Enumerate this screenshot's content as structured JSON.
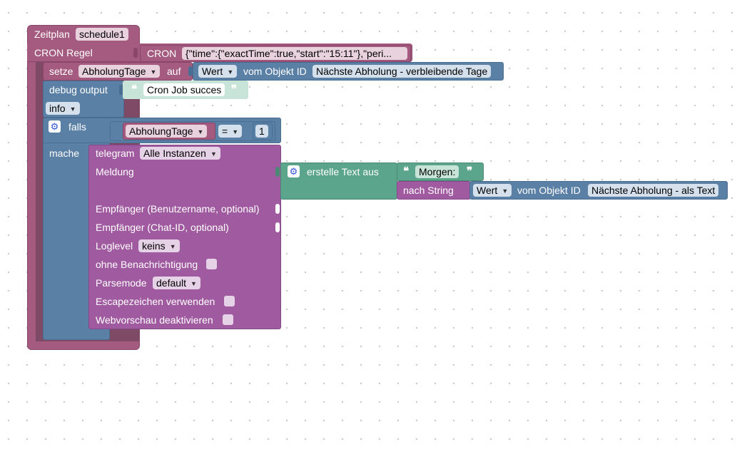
{
  "schedule": {
    "label": "Zeitplan",
    "name": "schedule1",
    "cron_label": "CRON Regel",
    "cron_block_label": "CRON",
    "cron_value": "{\"time\":{\"exactTime\":true,\"start\":\"15:11\"},\"peri..."
  },
  "set_block": {
    "label": "setze",
    "variable": "AbholungTage",
    "to_label": "auf",
    "value_attr": "Wert",
    "from_label": "vom Objekt ID",
    "object_id": "Nächste Abholung - verbleibende Tage"
  },
  "debug_block": {
    "label": "debug output",
    "text": "Cron Job succes",
    "level": "info"
  },
  "if_block": {
    "label": "falls",
    "do_label": "mache",
    "variable": "AbholungTage",
    "operator": "=",
    "number": "1"
  },
  "telegram_block": {
    "label": "telegram",
    "instance": "Alle Instanzen",
    "message_label": "Meldung",
    "recipient_user_label": "Empfänger (Benutzername, optional)",
    "recipient_chat_label": "Empfänger (Chat-ID, optional)",
    "loglevel_label": "Loglevel",
    "loglevel_value": "keins",
    "silent_label": "ohne Benachrichtigung",
    "parsemode_label": "Parsemode",
    "parsemode_value": "default",
    "escape_label": "Escapezeichen verwenden",
    "webpreview_label": "Webvorschau deaktivieren"
  },
  "text_join_block": {
    "label": "erstelle Text aus",
    "text": "Morgen:",
    "to_string_label": "nach String",
    "value_attr": "Wert",
    "from_label": "vom Objekt ID",
    "object_id": "Nächste Abholung - als Text"
  },
  "colors": {
    "schedule": "#a55b80",
    "schedule_dark": "#7f3f60",
    "variable": "#a55b80",
    "object": "#5b80a5",
    "debug": "#5b80a5",
    "logic": "#5b80a5",
    "telegram": "#a05aa0",
    "text": "#5ba58c",
    "text_light": "#c8e4d8",
    "to_string": "#a05aa0"
  },
  "icons": {
    "gear": "gear-icon",
    "dropdown": "dropdown-arrow-icon",
    "quote": "quote-icon"
  }
}
